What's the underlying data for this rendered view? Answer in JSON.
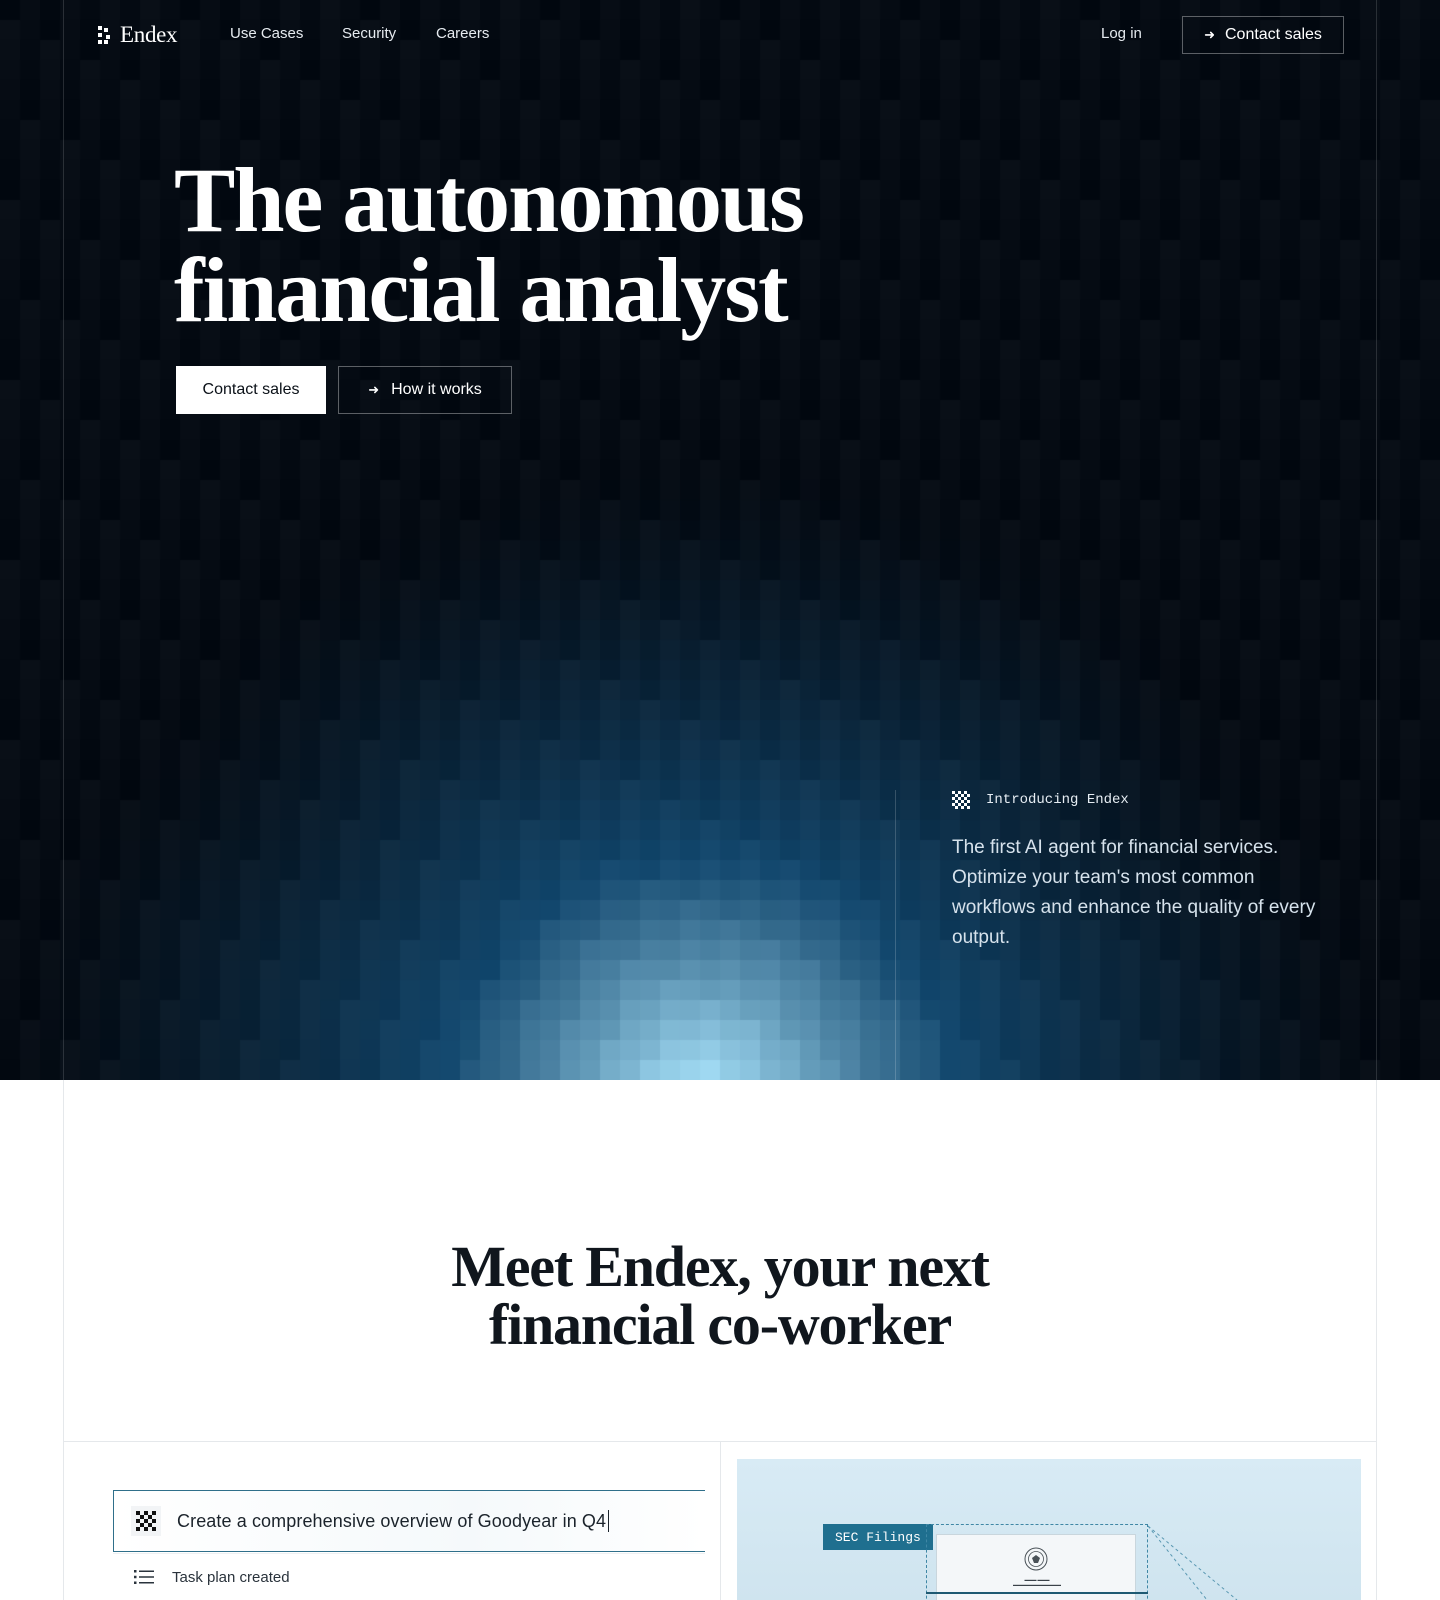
{
  "nav": {
    "brand": "Endex",
    "links": [
      "Use Cases",
      "Security",
      "Careers"
    ],
    "login": "Log in",
    "cta": "Contact sales"
  },
  "hero": {
    "headline_line1": "The autonomous",
    "headline_line2": "financial analyst",
    "primary_cta": "Contact sales",
    "secondary_cta": "How it works",
    "intro_label": "Introducing Endex",
    "intro_text": "The first AI agent for financial services. Optimize your team's most common workflows and enhance the quality of every output."
  },
  "section": {
    "title_line1": "Meet Endex, your next",
    "title_line2": "financial co-worker"
  },
  "demo": {
    "prompt": "Create a comprehensive overview of Goodyear in Q4",
    "task": "Task plan created",
    "tag": "SEC Filings"
  },
  "colors": {
    "hero_bg": "#050b13",
    "glow": "#aee8ff",
    "accent": "#1f6f8f"
  },
  "icons": {
    "logo": "endex-dots-icon",
    "arrow": "arrow-right-icon",
    "intro": "checker-icon",
    "task": "list-icon"
  }
}
